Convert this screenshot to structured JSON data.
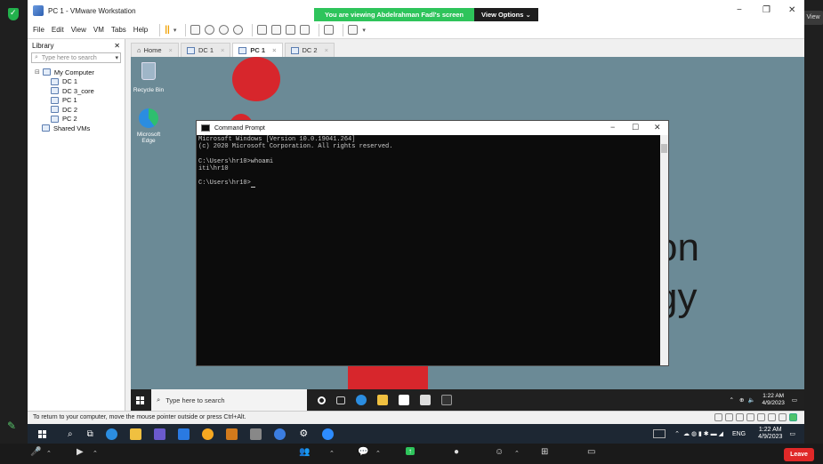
{
  "vmware": {
    "title": "PC 1 - VMware Workstation",
    "menu": [
      "File",
      "Edit",
      "View",
      "VM",
      "Tabs",
      "Help"
    ]
  },
  "share_banner": {
    "message": "You are viewing Abdelrahman Fadl's screen",
    "view_options": "View Options"
  },
  "zoom": {
    "view_label": "View",
    "leave": "Leave"
  },
  "library": {
    "title": "Library",
    "search_placeholder": "Type here to search",
    "root": "My Computer",
    "vms": [
      "DC 1",
      "DC 3_core",
      "PC 1",
      "DC 2",
      "PC 2"
    ],
    "shared": "Shared VMs"
  },
  "tabs": [
    {
      "label": "Home",
      "active": false
    },
    {
      "label": "DC 1",
      "active": false
    },
    {
      "label": "PC 1",
      "active": true
    },
    {
      "label": "DC 2",
      "active": false
    }
  ],
  "desktop": {
    "icons": [
      "Recycle Bin",
      "Microsoft Edge"
    ],
    "wallpaper_text": [
      "on",
      "gy"
    ]
  },
  "cmd": {
    "title": "Command Prompt",
    "lines": [
      "Microsoft Windows [Version 10.0.19041.264]",
      "(c) 2020 Microsoft Corporation. All rights reserved.",
      "",
      "C:\\Users\\hr10>whoami",
      "iti\\hr10",
      "",
      "C:\\Users\\hr10>"
    ]
  },
  "guest_taskbar": {
    "search_placeholder": "Type here to search",
    "time": "1:22 AM",
    "date": "4/9/2023"
  },
  "vm_status": {
    "hint": "To return to your computer, move the mouse pointer outside or press Ctrl+Alt."
  },
  "host_taskbar": {
    "lang": "ENG",
    "time": "1:22 AM",
    "date": "4/9/2023"
  },
  "colors": {
    "share_green": "#2ec45b",
    "leave_red": "#e02828",
    "wallpaper": "#6b8a96",
    "accent_red": "#d7262c"
  }
}
